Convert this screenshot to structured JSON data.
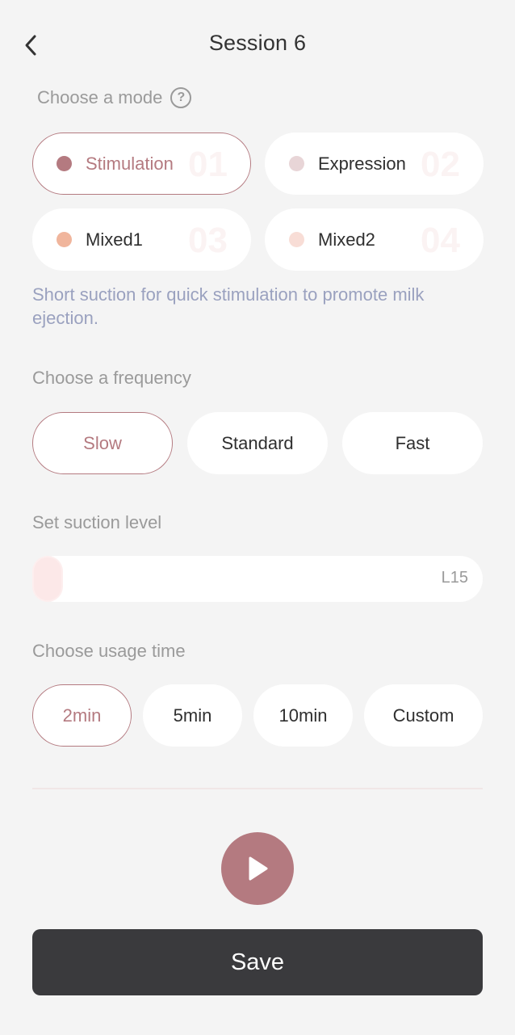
{
  "header": {
    "title": "Session 6"
  },
  "mode": {
    "label": "Choose a mode",
    "help_symbol": "?",
    "options": [
      {
        "name": "Stimulation",
        "number": "01",
        "dot_color": "#b47a80",
        "selected": true
      },
      {
        "name": "Expression",
        "number": "02",
        "dot_color": "#e8d5d7",
        "selected": false
      },
      {
        "name": "Mixed1",
        "number": "03",
        "dot_color": "#f0b59c",
        "selected": false
      },
      {
        "name": "Mixed2",
        "number": "04",
        "dot_color": "#f8ddd6",
        "selected": false
      }
    ],
    "description": "Short suction for quick stimulation to promote milk ejection."
  },
  "frequency": {
    "label": "Choose a frequency",
    "options": [
      {
        "name": "Slow",
        "selected": true
      },
      {
        "name": "Standard",
        "selected": false
      },
      {
        "name": "Fast",
        "selected": false
      }
    ]
  },
  "suction": {
    "label": "Set suction level",
    "level_text": "L15",
    "level_fraction": 0.0
  },
  "usage_time": {
    "label": "Choose usage time",
    "options": [
      {
        "name": "2min",
        "selected": true
      },
      {
        "name": "5min",
        "selected": false
      },
      {
        "name": "10min",
        "selected": false
      },
      {
        "name": "Custom",
        "selected": false
      }
    ]
  },
  "actions": {
    "save_label": "Save"
  },
  "colors": {
    "accent": "#b47a80",
    "background": "#f4f4f4",
    "description_text": "#9aa1bf",
    "save_button": "#3a3a3d"
  },
  "icons": {
    "back": "chevron-left-icon",
    "help": "question-circle-icon",
    "play": "play-icon"
  }
}
